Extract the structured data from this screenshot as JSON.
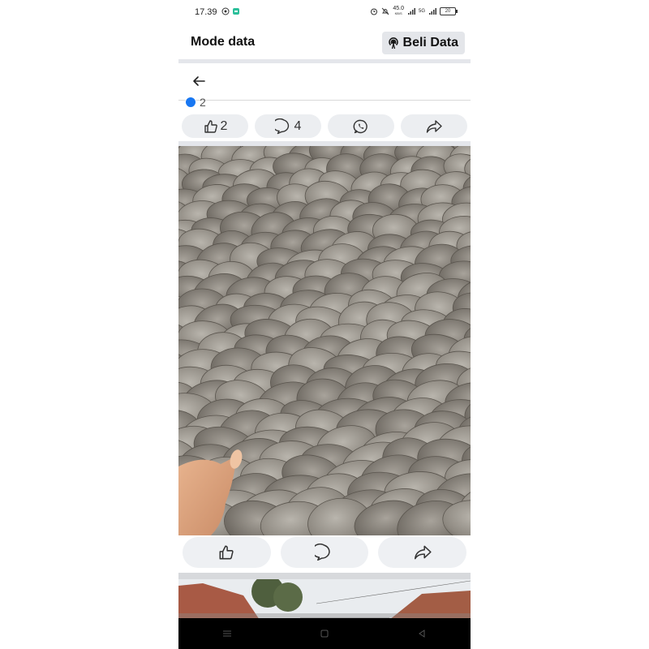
{
  "status_bar": {
    "time": "17.39",
    "speed": "45.0",
    "speed_unit": "KB/S",
    "network": "5G",
    "battery": "20"
  },
  "app": {
    "title": "Mode data",
    "buy_button_label": "Beli Data",
    "buy_button_icon": "broadcast-icon"
  },
  "post": {
    "reaction_count": "2",
    "pills": {
      "like_count": "2",
      "comment_count": "4"
    }
  },
  "colors": {
    "accent": "#1877f2",
    "pill_bg": "#eceef1",
    "divider": "#e4e6eb"
  }
}
